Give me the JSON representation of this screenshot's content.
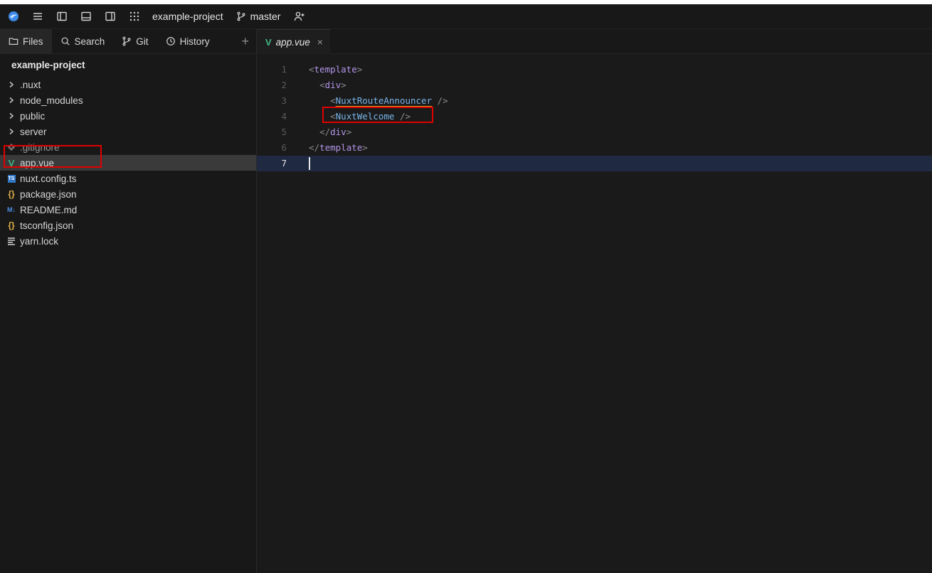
{
  "titlebar": {
    "project": "example-project",
    "branch": "master"
  },
  "sidebar": {
    "tabs": [
      {
        "label": "Files",
        "icon": "folder-icon"
      },
      {
        "label": "Search",
        "icon": "search-icon"
      },
      {
        "label": "Git",
        "icon": "git-branch-icon"
      },
      {
        "label": "History",
        "icon": "history-icon"
      }
    ],
    "add_label": "+",
    "project_title": "example-project",
    "tree": [
      {
        "name": ".nuxt",
        "kind": "folder"
      },
      {
        "name": "node_modules",
        "kind": "folder"
      },
      {
        "name": "public",
        "kind": "folder"
      },
      {
        "name": "server",
        "kind": "folder"
      },
      {
        "name": ".gitignore",
        "kind": "git"
      },
      {
        "name": "app.vue",
        "kind": "vue",
        "selected": true
      },
      {
        "name": "nuxt.config.ts",
        "kind": "ts"
      },
      {
        "name": "package.json",
        "kind": "json"
      },
      {
        "name": "README.md",
        "kind": "md"
      },
      {
        "name": "tsconfig.json",
        "kind": "json"
      },
      {
        "name": "yarn.lock",
        "kind": "text"
      }
    ]
  },
  "editor": {
    "tab_label": "app.vue",
    "tab_close": "×",
    "lines": [
      {
        "num": "1",
        "indent": "",
        "open": "<",
        "tag": "template",
        "close": ">",
        "comp": ""
      },
      {
        "num": "2",
        "indent": "  ",
        "open": "<",
        "tag": "div",
        "close": ">",
        "comp": ""
      },
      {
        "num": "3",
        "indent": "    ",
        "open": "<",
        "tag": "",
        "close": " />",
        "comp": "NuxtRouteAnnouncer"
      },
      {
        "num": "4",
        "indent": "    ",
        "open": "<",
        "tag": "",
        "close": " />",
        "comp": "NuxtWelcome"
      },
      {
        "num": "5",
        "indent": "  ",
        "open": "</",
        "tag": "div",
        "close": ">",
        "comp": ""
      },
      {
        "num": "6",
        "indent": "",
        "open": "</",
        "tag": "template",
        "close": ">",
        "comp": ""
      },
      {
        "num": "7",
        "indent": "",
        "open": "",
        "tag": "",
        "close": "",
        "comp": ""
      }
    ],
    "current_line": 7
  },
  "colors": {
    "accent_highlight": "#e00000",
    "vue_green": "#41b883",
    "current_line_bg": "#1f2942"
  }
}
